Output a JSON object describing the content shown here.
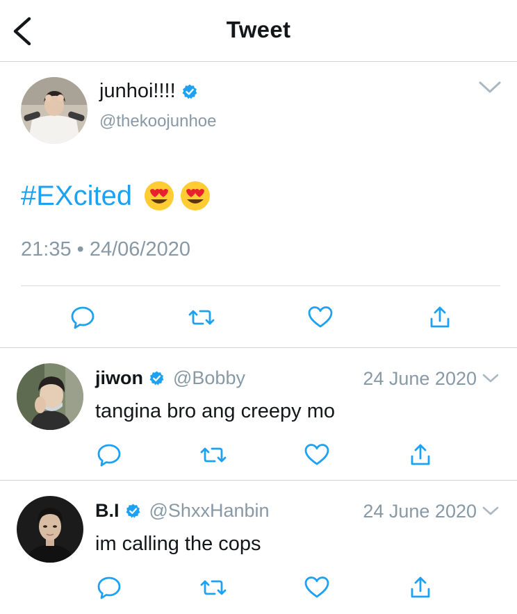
{
  "header": {
    "title": "Tweet"
  },
  "main_tweet": {
    "author_name": "junhoi!!!!",
    "verified": true,
    "handle": "@thekoojunhoe",
    "hashtag": "#EXcited",
    "emojis": [
      "heart-eyes-emoji",
      "heart-eyes-emoji"
    ],
    "timestamp": "21:35 • 24/06/2020"
  },
  "replies": [
    {
      "author_name": "jiwon",
      "verified": true,
      "handle": "@Bobby",
      "date": "24 June 2020",
      "text": "tangina bro ang creepy mo"
    },
    {
      "author_name": "B.I",
      "verified": true,
      "handle": "@ShxxHanbin",
      "date": "24 June 2020",
      "text": "im calling the cops"
    }
  ],
  "colors": {
    "accent": "#1da1f2",
    "muted_text": "#8899a6",
    "action_icons": "#1da1f2",
    "divider": "#cfd3d6"
  },
  "icons": [
    "back-arrow-icon",
    "verified-badge-icon",
    "chevron-down-icon",
    "reply-icon",
    "retweet-icon",
    "like-icon",
    "share-icon"
  ]
}
